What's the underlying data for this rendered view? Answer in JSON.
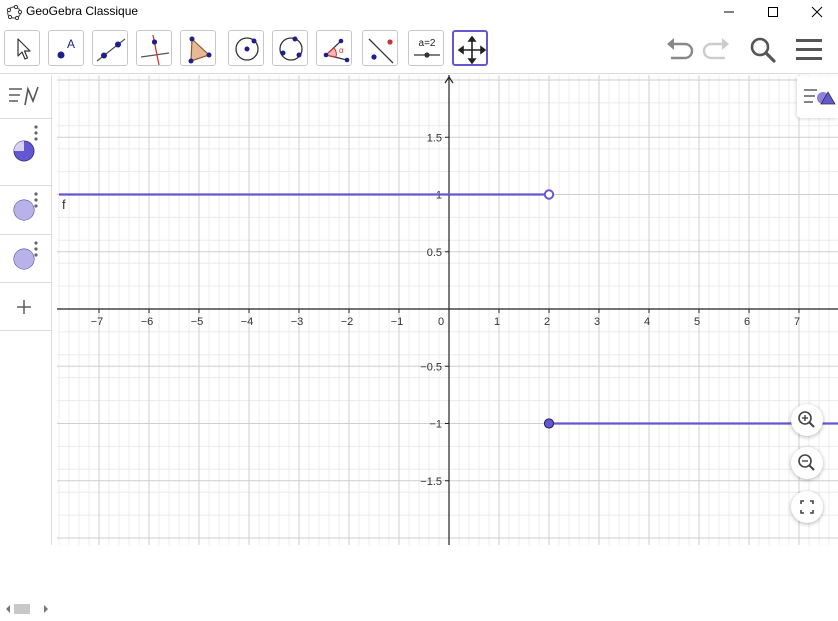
{
  "window": {
    "title": "GeoGebra Classique"
  },
  "toolbar": {
    "tools": [
      {
        "name": "move-tool"
      },
      {
        "name": "point-tool"
      },
      {
        "name": "line-tool"
      },
      {
        "name": "perpendicular-line-tool"
      },
      {
        "name": "polygon-tool"
      },
      {
        "name": "circle-center-point-tool"
      },
      {
        "name": "circle-three-points-tool"
      },
      {
        "name": "angle-tool"
      },
      {
        "name": "reflect-tool"
      },
      {
        "name": "slider-tool",
        "label": "a=2"
      },
      {
        "name": "move-graphics-view-tool",
        "active": true
      }
    ]
  },
  "graphics": {
    "x_ticks": [
      "−7",
      "−6",
      "−5",
      "−4",
      "−3",
      "−2",
      "−1",
      "0",
      "1",
      "2",
      "3",
      "4",
      "5",
      "6",
      "7"
    ],
    "y_ticks_pos": [
      "0.5",
      "1",
      "1.5"
    ],
    "y_ticks_neg": [
      "−0.5",
      "−1",
      "−1.5"
    ],
    "function_label": "f",
    "function_color": "#6557d2"
  },
  "chart_data": {
    "type": "line",
    "title": "",
    "xlabel": "",
    "ylabel": "",
    "xlim": [
      -7.8,
      7.8
    ],
    "ylim": [
      -2.0,
      2.05
    ],
    "grid": true,
    "series": [
      {
        "name": "f",
        "segments": [
          {
            "x": [
              -7.8,
              2
            ],
            "y": [
              1,
              1
            ],
            "end": "open"
          },
          {
            "x": [
              2,
              7.8
            ],
            "y": [
              -1,
              -1
            ],
            "start": "closed"
          }
        ]
      }
    ]
  }
}
